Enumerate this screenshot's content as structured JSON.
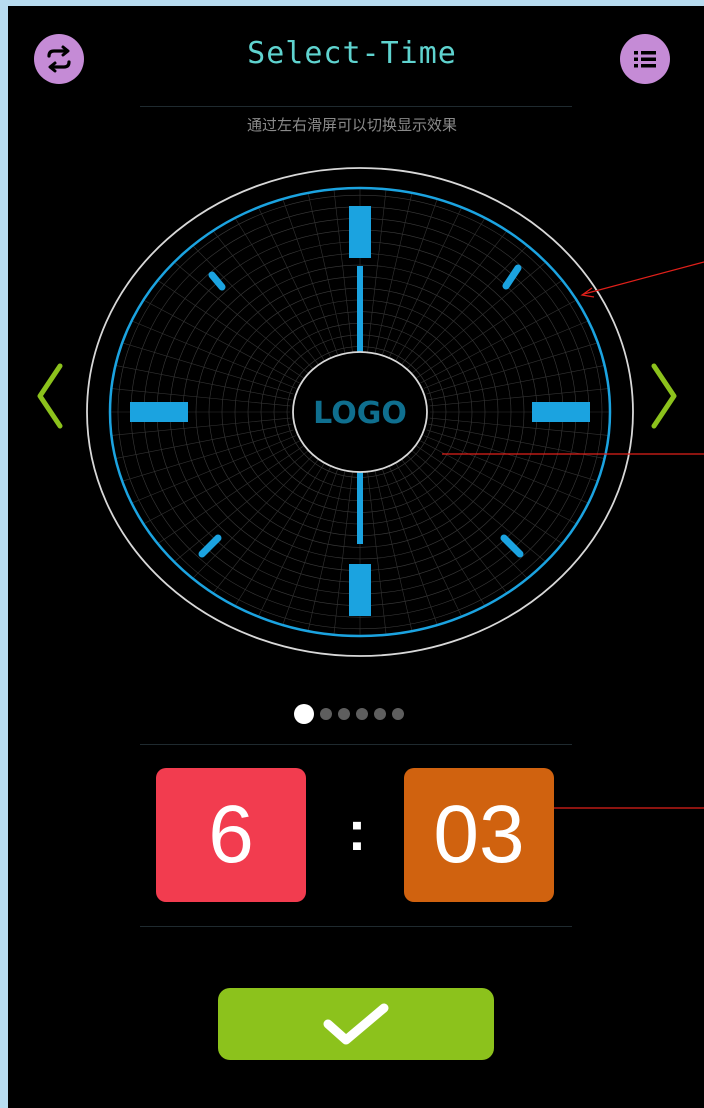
{
  "header": {
    "title": "Select-Time",
    "subtitle": "通过左右滑屏可以切换显示效果",
    "left_icon": "swap-icon",
    "right_icon": "menu-list-icon"
  },
  "clock": {
    "logo_text": "LOGO",
    "accent_color": "#1ba3e0",
    "logo_color": "#0f6f8f"
  },
  "navigation": {
    "prev_icon": "chevron-left-icon",
    "next_icon": "chevron-right-icon",
    "arrow_color": "#8cc21c"
  },
  "pagination": {
    "total": 6,
    "active_index": 0
  },
  "time": {
    "hours": "6",
    "separator": ":",
    "minutes": "03",
    "hours_color": "#f23c4f",
    "minutes_color": "#d0620f"
  },
  "confirm": {
    "icon": "checkmark-icon",
    "color": "#8cc21c"
  }
}
